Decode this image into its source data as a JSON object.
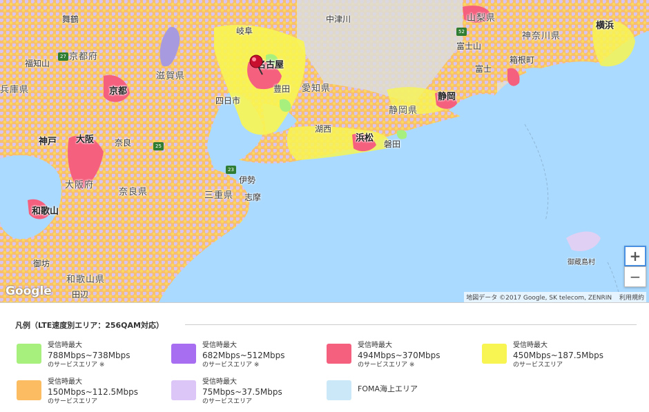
{
  "map": {
    "places": [
      {
        "id": "fukuchiyama",
        "text": "福知山"
      },
      {
        "id": "kyotofu",
        "text": "京都府"
      },
      {
        "id": "hyogo",
        "text": "兵庫県"
      },
      {
        "id": "shigaken",
        "text": "滋賀県"
      },
      {
        "id": "kyoto",
        "text": "京都"
      },
      {
        "id": "ayabe",
        "text": "舞鶴"
      },
      {
        "id": "gifu",
        "text": "岐阜"
      },
      {
        "id": "nagoya",
        "text": "名古屋"
      },
      {
        "id": "toyota",
        "text": "豊田"
      },
      {
        "id": "aichi",
        "text": "愛知県"
      },
      {
        "id": "yokkaichi",
        "text": "四日市"
      },
      {
        "id": "nakatsugawa",
        "text": "中津川"
      },
      {
        "id": "yamanashi",
        "text": "山梨県"
      },
      {
        "id": "kanagawa",
        "text": "神奈川県"
      },
      {
        "id": "yokohama",
        "text": "横浜"
      },
      {
        "id": "fujisan",
        "text": "富士山"
      },
      {
        "id": "hakone",
        "text": "箱根町"
      },
      {
        "id": "fuji",
        "text": "富士"
      },
      {
        "id": "shizuoka",
        "text": "静岡"
      },
      {
        "id": "shizuokaken",
        "text": "静岡県"
      },
      {
        "id": "hamamatsu",
        "text": "浜松"
      },
      {
        "id": "iwata",
        "text": "磐田"
      },
      {
        "id": "kobe",
        "text": "神戸"
      },
      {
        "id": "osaka",
        "text": "大阪"
      },
      {
        "id": "nara",
        "text": "奈良"
      },
      {
        "id": "osakafu",
        "text": "大阪府"
      },
      {
        "id": "naraken",
        "text": "奈良県"
      },
      {
        "id": "mie",
        "text": "三重県"
      },
      {
        "id": "ise",
        "text": "伊勢"
      },
      {
        "id": "shima",
        "text": "志摩"
      },
      {
        "id": "wakayama",
        "text": "和歌山"
      },
      {
        "id": "wakayamaken",
        "text": "和歌山県"
      },
      {
        "id": "gobo",
        "text": "御坊"
      },
      {
        "id": "tanabe",
        "text": "田辺"
      },
      {
        "id": "mikurajima",
        "text": "御蔵島村"
      },
      {
        "id": "kosai",
        "text": "湖西"
      }
    ],
    "zoom_in_label": "+",
    "zoom_out_label": "−",
    "google_logo": "Google",
    "attribution": "地図データ ©2017 Google, SK telecom, ZENRIN",
    "terms": "利用規約"
  },
  "legend": {
    "title": "凡例（LTE速度別エリア：256QAM対応）",
    "items": [
      {
        "line1": "受信時最大",
        "speed": "788Mbps~738Mbps",
        "note": "のサービスエリア ※",
        "color": "#a8f07e"
      },
      {
        "line1": "受信時最大",
        "speed": "682Mbps~512Mbps",
        "note": "のサービスエリア ※",
        "color": "#a86ef2"
      },
      {
        "line1": "受信時最大",
        "speed": "494Mbps~370Mbps",
        "note": "のサービスエリア ※",
        "color": "#f5607e"
      },
      {
        "line1": "受信時最大",
        "speed": "450Mbps~187.5Mbps",
        "note": "のサービスエリア",
        "color": "#f8f552"
      },
      {
        "line1": "受信時最大",
        "speed": "150Mbps~112.5Mbps",
        "note": "のサービスエリア",
        "color": "#fcbc62"
      },
      {
        "line1": "受信時最大",
        "speed": "75Mbps~37.5Mbps",
        "note": "のサービスエリア",
        "color": "#dcc6f8"
      },
      {
        "line1": "",
        "speed": "FOMA海上エリア",
        "note": "",
        "color": "#cbe8f8"
      }
    ]
  },
  "colors": {
    "sea": "#aadaff",
    "land": "#d9d9d9",
    "lte_orange": "#fcbc62",
    "lte_purple_light": "#dcc6f8",
    "lte_yellow": "#f8f552",
    "lte_red": "#f5607e"
  }
}
